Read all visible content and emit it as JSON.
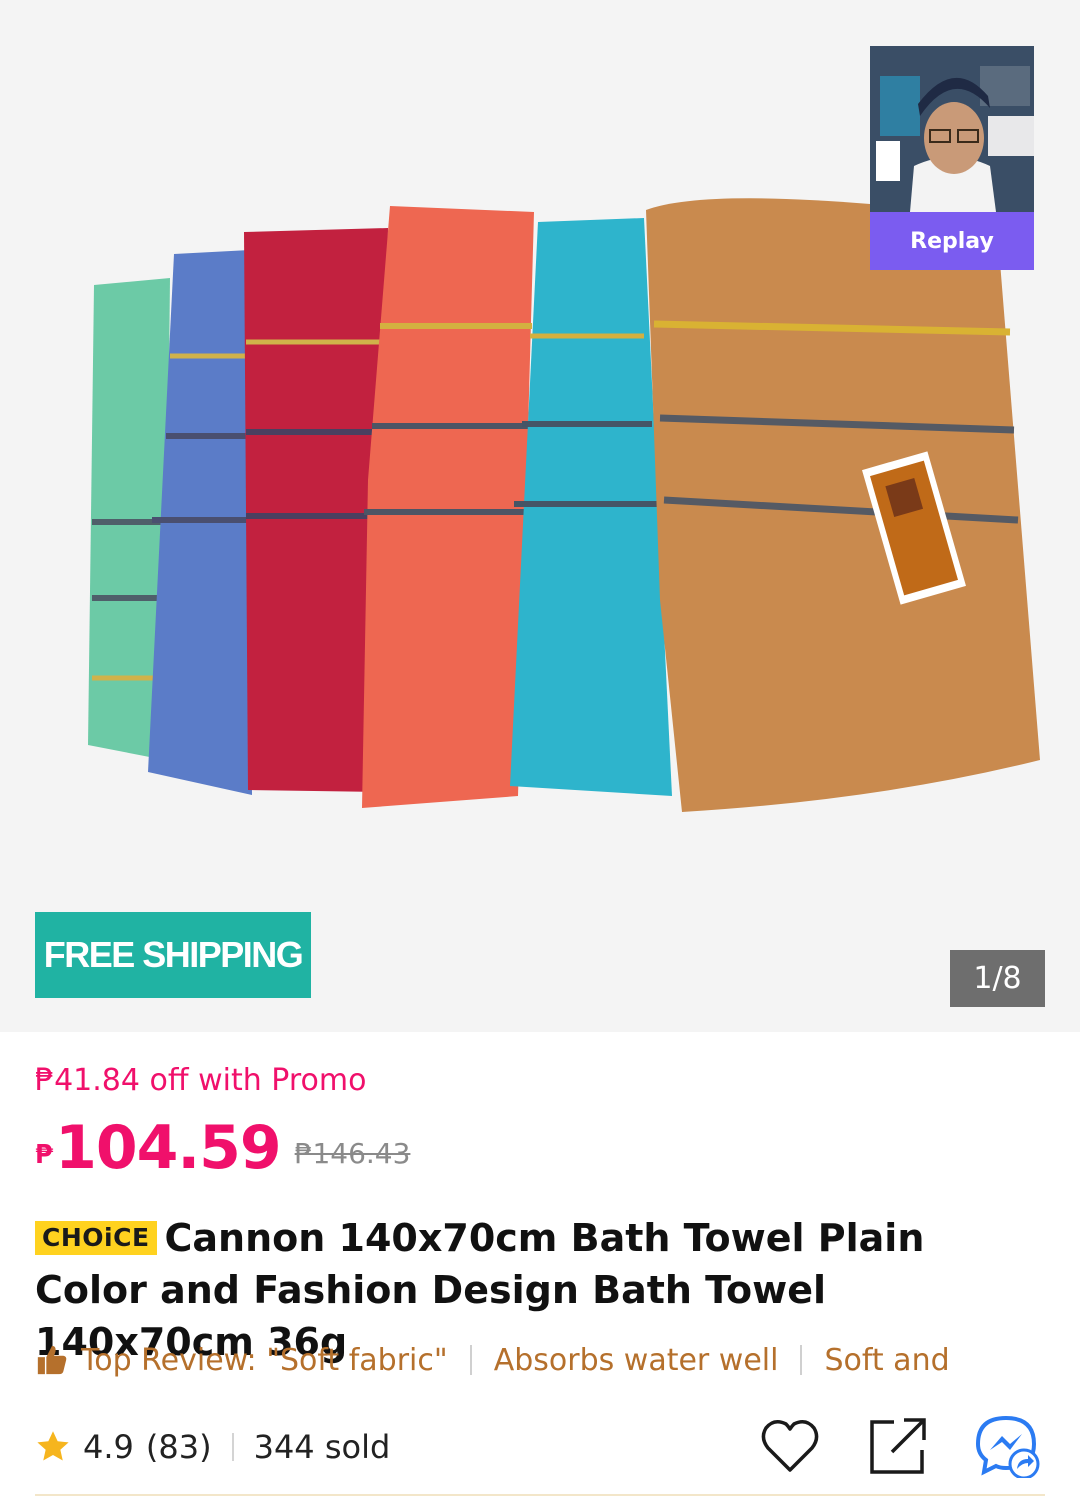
{
  "gallery": {
    "video_replay_label": "Replay",
    "shipping_badge": "FREE SHIPPING",
    "image_counter": "1/8",
    "towel_colors": [
      "#6ccaa6",
      "#5b7cc8",
      "#c2213f",
      "#ee6751",
      "#2eb4cc",
      "#c98a4e"
    ]
  },
  "pricing": {
    "promo_text": "₱41.84 off with Promo",
    "currency_symbol": "₱",
    "current_price": "104.59",
    "original_price": "₱146.43",
    "accent_color": "#f0106b"
  },
  "product": {
    "badge": "CHOiCE",
    "title": "Cannon 140x70cm Bath Towel Plain Color and Fashion Design Bath Towel 140x70cm 36g"
  },
  "review_highlights": {
    "items": [
      "Top Review: \"Soft fabric\"",
      "Absorbs water well",
      "Soft and"
    ]
  },
  "stats": {
    "rating": "4.9",
    "review_count": "(83)",
    "sold": "344 sold"
  },
  "actions": {
    "icons": [
      "heart-icon",
      "share-icon",
      "messenger-icon"
    ]
  }
}
